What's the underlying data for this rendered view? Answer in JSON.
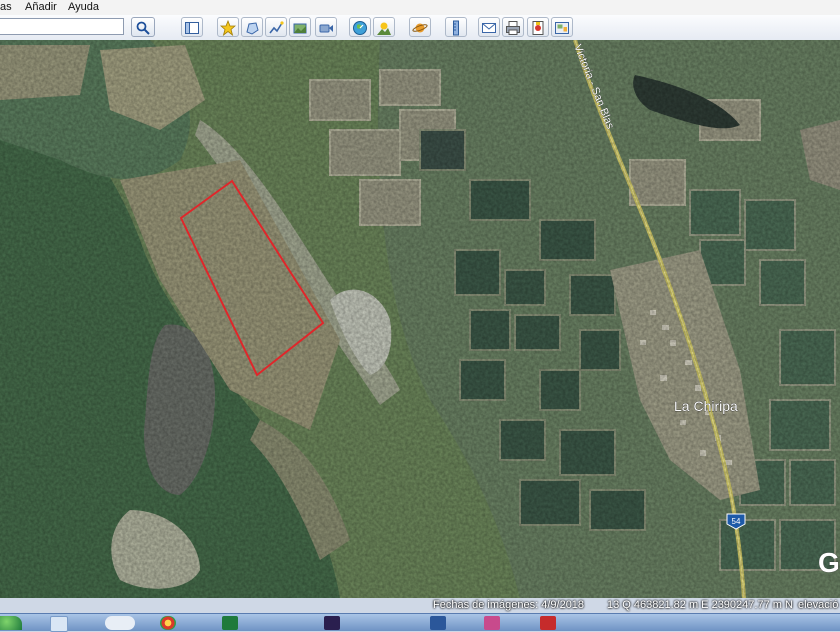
{
  "menu": {
    "item_partial": "as",
    "item_add": "Añadir",
    "item_help": "Ayuda"
  },
  "search": {
    "value": ""
  },
  "toolbar": {
    "icons": [
      "sidebar-icon",
      "placemark-icon",
      "polygon-icon",
      "path-icon",
      "image-overlay-icon",
      "record-tour-icon",
      "historical-imagery-icon",
      "sunlight-icon",
      "planets-icon",
      "ruler-icon",
      "email-icon",
      "print-icon",
      "save-image-icon",
      "view-in-maps-icon"
    ]
  },
  "map": {
    "place_label": "La Chiripa",
    "road_label": "Victoria - San Blas",
    "highway_number": "54",
    "logo_letter": "G",
    "colors": {
      "boundary": "#e0262a",
      "road": "#d7cf6a",
      "label_text": "#ffffff"
    }
  },
  "status": {
    "imagery_date": "Fechas de imágenes: 4/9/2018",
    "coordinates": "13 Q 463821.82 m E 2390247.77 m N",
    "elevation_partial": "elevació"
  },
  "taskbar": {
    "apps": [
      "start-orb-icon",
      "chrome-icon",
      "excel-icon",
      "premiere-icon",
      "word-icon",
      "media-icon",
      "pdf-icon"
    ]
  }
}
